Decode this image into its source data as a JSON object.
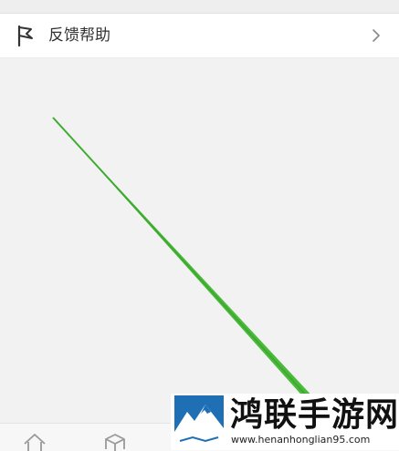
{
  "menu": {
    "feedback_label": "反馈帮助",
    "icon": "flag-icon",
    "chevron_icon": "chevron-right-icon"
  },
  "bottom_nav": {
    "icons": [
      "home-icon",
      "box-icon"
    ]
  },
  "watermark": {
    "title": "鸿联手游网",
    "url": "www.henanhonglian95.com"
  },
  "colors": {
    "background": "#f2f2f2",
    "stroke_green": "#4cba3c",
    "logo_blue": "#1f6fb5"
  }
}
